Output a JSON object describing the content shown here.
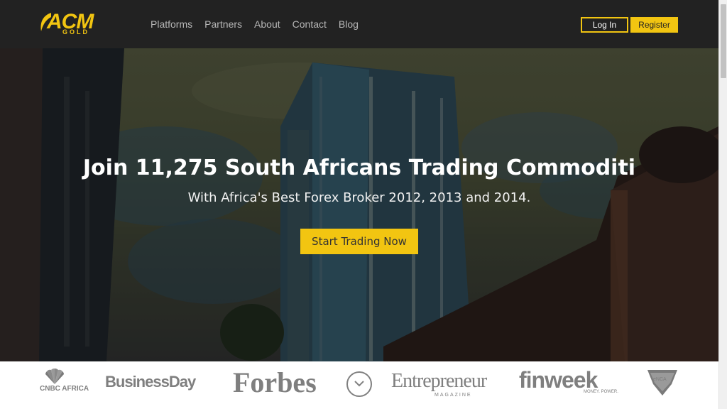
{
  "brand": {
    "name": "ACM",
    "sub": "GOLD",
    "accent": "#f2c511"
  },
  "nav": {
    "items": [
      "Platforms",
      "Partners",
      "About",
      "Contact",
      "Blog"
    ]
  },
  "auth": {
    "login_label": "Log In",
    "register_label": "Register"
  },
  "hero": {
    "title": "Join 11,275 South Africans Trading Commoditi",
    "subtitle": "With Africa's Best Forex Broker 2012, 2013 and 2014.",
    "cta_label": "Start Trading Now"
  },
  "press": {
    "cnbc": "CNBC AFRICA",
    "businessday": "BusinessDay",
    "forbes": "Forbes",
    "entrepreneur": "Entrepreneur",
    "entrepreneur_sub": "MAGAZINE",
    "finweek": "finweek",
    "finweek_sub": "MONEY. POWER.",
    "enca": "eNCA"
  },
  "icons": {
    "scroll_down": "chevron-down-icon"
  }
}
